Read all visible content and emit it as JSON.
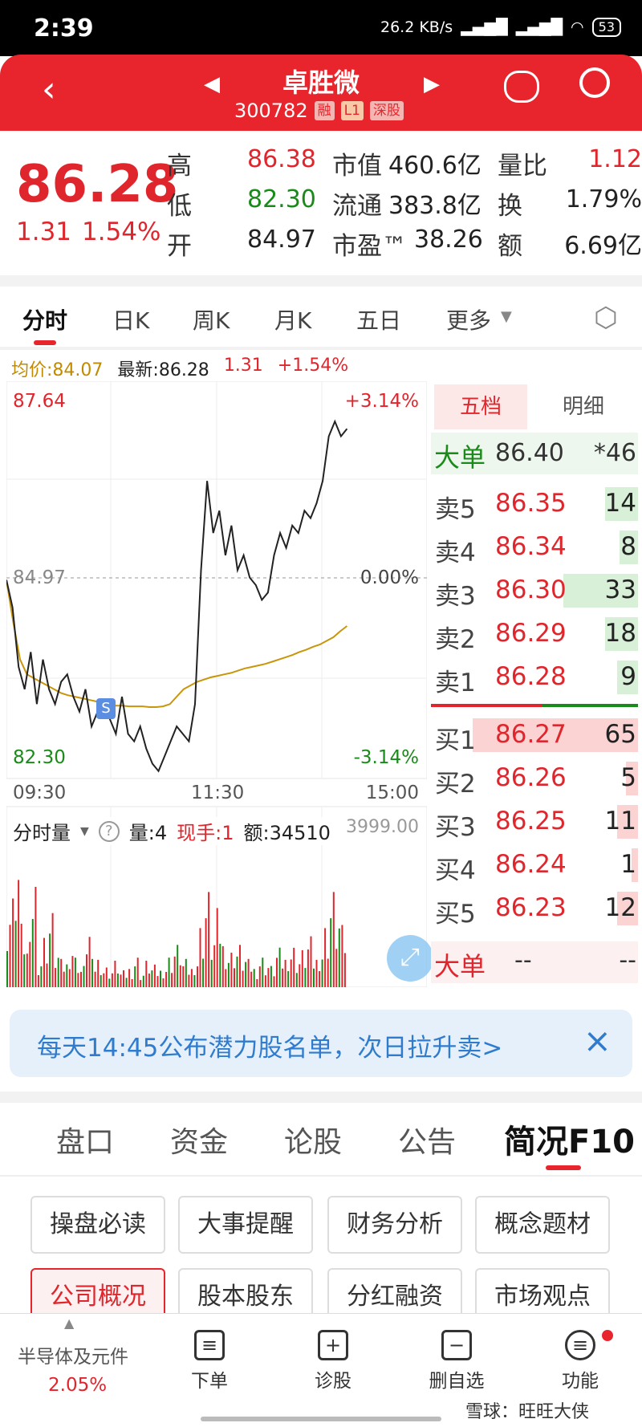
{
  "status": {
    "time": "2:39",
    "net": "26.2 KB/s",
    "signal": "HD",
    "battery": "53"
  },
  "header": {
    "title": "卓胜微",
    "code": "300782",
    "tags": [
      "融",
      "L1",
      "深股"
    ]
  },
  "quote": {
    "price": "86.28",
    "change": "1.31",
    "pct": "1.54%",
    "high_label": "高",
    "high": "86.38",
    "low_label": "低",
    "low": "82.30",
    "open_label": "开",
    "open": "84.97",
    "mcap_label": "市值",
    "mcap": "460.6亿",
    "float_label": "流通",
    "float": "383.8亿",
    "pe_label": "市盈™",
    "pe": "38.26",
    "vr_label": "量比",
    "vr": "1.12",
    "turn_label": "换",
    "turn": "1.79%",
    "amt_label": "额",
    "amt": "6.69亿"
  },
  "ktabs": [
    "分时",
    "日K",
    "周K",
    "月K",
    "五日",
    "更多"
  ],
  "chart_info": {
    "avg": "均价:84.07",
    "latest": "最新:86.28",
    "chg": "1.31",
    "pct": "+1.54%"
  },
  "chart_data": {
    "type": "line",
    "y_top": "87.64",
    "y_mid": "84.97",
    "y_bot": "82.30",
    "pct_top": "+3.14%",
    "pct_mid": "0.00%",
    "pct_bot": "-3.14%",
    "x_labels": [
      "09:30",
      "11:30",
      "15:00"
    ],
    "ylim": [
      82.3,
      87.64
    ],
    "series": [
      {
        "values": [
          84.97,
          84.6,
          83.8,
          83.5,
          84.0,
          83.3,
          83.9,
          83.5,
          83.3,
          83.6,
          83.7,
          83.4,
          83.2,
          83.5,
          83.0,
          83.2,
          83.3,
          83.1,
          82.9,
          83.4,
          82.9,
          82.8,
          83.0,
          82.7,
          82.5,
          82.4,
          82.6,
          82.8,
          83.0,
          82.9,
          82.8,
          83.3,
          85.1,
          86.3,
          85.6,
          85.9,
          85.3,
          85.7,
          85.1,
          85.3,
          85.0,
          84.9,
          84.7,
          84.8,
          85.3,
          85.6,
          85.4,
          85.7,
          85.6,
          85.9,
          85.8,
          86.0,
          86.3,
          86.9,
          87.1,
          86.9,
          87.0
        ]
      },
      {
        "values": [
          84.97,
          84.4,
          83.9,
          83.7,
          83.65,
          83.6,
          83.55,
          83.5,
          83.45,
          83.42,
          83.4,
          83.38,
          83.36,
          83.34,
          83.32,
          83.3,
          83.28,
          83.28,
          83.27,
          83.27,
          83.27,
          83.26,
          83.26,
          83.27,
          83.3,
          83.4,
          83.5,
          83.55,
          83.6,
          83.63,
          83.66,
          83.68,
          83.7,
          83.72,
          83.75,
          83.78,
          83.8,
          83.82,
          83.84,
          83.87,
          83.9,
          83.93,
          83.96,
          84.0,
          84.03,
          84.07,
          84.1,
          84.15,
          84.2,
          84.28,
          84.35
        ]
      }
    ]
  },
  "vol_bar": {
    "label": "分时量",
    "vol": "量:4",
    "hand": "现手:1",
    "amt": "额:34510",
    "max": "3999.00"
  },
  "book": {
    "tabs": [
      "五档",
      "明细"
    ],
    "big_top": {
      "label": "大单",
      "price": "86.40",
      "qty": "*46"
    },
    "sells": [
      {
        "n": "卖5",
        "p": "86.35",
        "q": "14",
        "w": 16
      },
      {
        "n": "卖4",
        "p": "86.34",
        "q": "8",
        "w": 9
      },
      {
        "n": "卖3",
        "p": "86.30",
        "q": "33",
        "w": 36
      },
      {
        "n": "卖2",
        "p": "86.29",
        "q": "18",
        "w": 16
      },
      {
        "n": "卖1",
        "p": "86.28",
        "q": "9",
        "w": 10
      }
    ],
    "buys": [
      {
        "n": "买1",
        "p": "86.27",
        "q": "65",
        "w": 80
      },
      {
        "n": "买2",
        "p": "86.26",
        "q": "5",
        "w": 6
      },
      {
        "n": "买3",
        "p": "86.25",
        "q": "11",
        "w": 10
      },
      {
        "n": "买4",
        "p": "86.24",
        "q": "1",
        "w": 3
      },
      {
        "n": "买5",
        "p": "86.23",
        "q": "12",
        "w": 10
      }
    ],
    "big_bot": {
      "label": "大单",
      "price": "--",
      "qty": "--"
    }
  },
  "banner": {
    "text": "每天14:45公布潜力股名单，次日拉升卖>"
  },
  "sections": [
    "盘口",
    "资金",
    "论股",
    "公告",
    "简况F10"
  ],
  "grid": [
    "操盘必读",
    "大事提醒",
    "财务分析",
    "概念题材",
    "公司概况",
    "股本股东",
    "分红融资",
    "市场观点"
  ],
  "bottom": {
    "sector": "半导体及元件",
    "sector_pct": "2.05%",
    "nav": [
      "下单",
      "诊股",
      "删自选",
      "功能"
    ],
    "watermark": "雪球：旺旺大侠"
  },
  "colors": {
    "accent": "#e8252c",
    "up": "#e0262d",
    "down": "#1a8a1a",
    "avg": "#c8960a"
  }
}
